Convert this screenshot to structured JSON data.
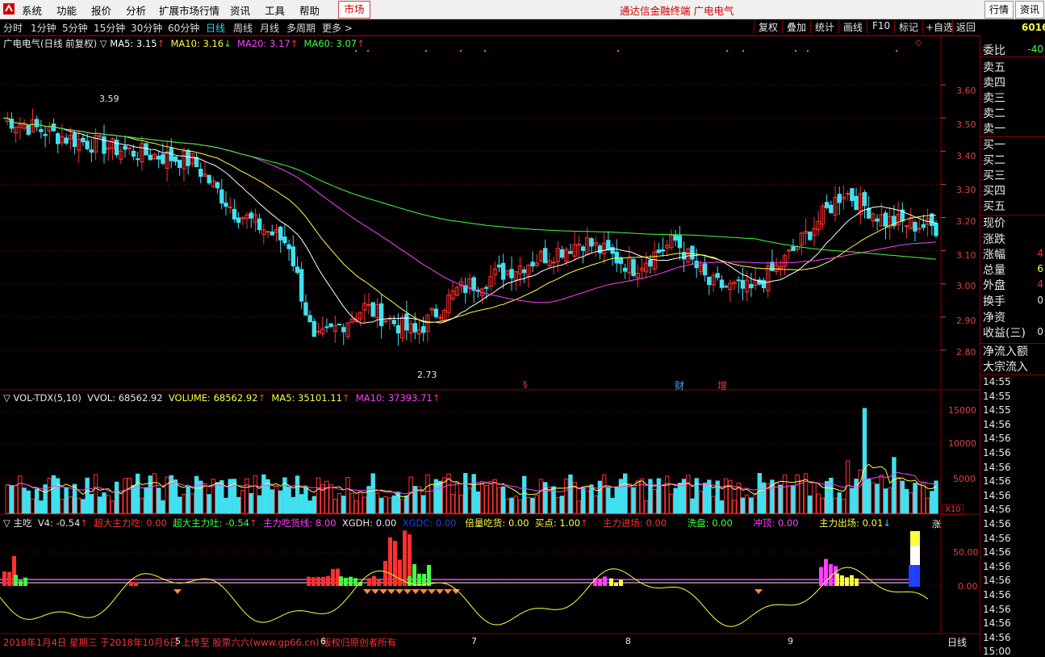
{
  "menu": {
    "items": [
      "系统",
      "功能",
      "报价",
      "分析",
      "扩展市场行情",
      "资讯",
      "工具",
      "帮助"
    ],
    "market_tab": "市场",
    "brand": "通达信金融终端  广电电气",
    "right_buttons": [
      "行情",
      "资讯"
    ]
  },
  "periods": [
    "分时",
    "1分钟",
    "5分钟",
    "15分钟",
    "30分钟",
    "60分钟",
    "日线",
    "周线",
    "月线",
    "多周期",
    "更多 >"
  ],
  "active_period": "日线",
  "tools": [
    "复权",
    "叠加",
    "统计",
    "画线",
    "F10",
    "标记",
    "+自选",
    "返回"
  ],
  "stock_code_partial": "6016",
  "main_chart": {
    "title": "广电电气(日线 前复权) ▽",
    "ma": [
      {
        "label": "MA5: 3.15",
        "arrow": "↑",
        "color": "#ffffff"
      },
      {
        "label": "MA10: 3.16",
        "arrow": "↓",
        "color": "#ffff40"
      },
      {
        "label": "MA20: 3.17",
        "arrow": "↑",
        "color": "#ff40ff"
      },
      {
        "label": "MA60: 3.07",
        "arrow": "↑",
        "color": "#40ff40"
      }
    ],
    "y_ticks": [
      "3.60",
      "3.50",
      "3.40",
      "3.30",
      "3.20",
      "3.10",
      "3.00",
      "2.90",
      "2.80"
    ],
    "ylim": [
      2.7,
      3.7
    ],
    "high_label": "3.59",
    "low_label": "2.73",
    "markers": [
      {
        "text": "§",
        "color": "#ff3030"
      },
      {
        "text": "财",
        "color": "#40a0ff"
      },
      {
        "text": "增",
        "color": "#ff3030"
      }
    ]
  },
  "volume_panel": {
    "name": "▽ VOL-TDX(5,10)",
    "vvol": "VVOL: 68562.92",
    "volume": "VOLUME: 68562.92",
    "ma5": "MA5: 35101.11",
    "ma10": "MA10: 37393.71",
    "y_ticks": [
      "15000",
      "10000",
      "5000"
    ],
    "scale": "X10"
  },
  "indicator_panel": {
    "name": "▽ 主吃",
    "fields": [
      {
        "label": "V4: -0.54",
        "arrow": "↑",
        "color": "#e8e8e8"
      },
      {
        "label": "超大主力吃: 0.00",
        "color": "#ff3030"
      },
      {
        "label": "超大主力吐: -0.54",
        "arrow": "↑",
        "color": "#40ff40"
      },
      {
        "label": "主力吃货线: 8.00",
        "color": "#ff40ff"
      },
      {
        "label": "XGDH: 0.00",
        "color": "#e8e8e8"
      },
      {
        "label": "XGDC: 0.00",
        "color": "#2040ff"
      },
      {
        "label": "倍量吃货: 0.00",
        "color": "#ffff40"
      },
      {
        "label": "买点: 1.00",
        "arrow": "↑",
        "color": "#ffff40"
      },
      {
        "label": "主力进场: 0.00",
        "color": "#ff3030"
      },
      {
        "label": "洗盘: 0.00",
        "color": "#40ff40"
      },
      {
        "label": "冲顶: 0.00",
        "color": "#ff40ff"
      },
      {
        "label": "主力出场: 0.01",
        "arrow": "↓",
        "color": "#ffff40"
      }
    ],
    "y_ticks": [
      "50.00",
      "0.00"
    ],
    "right_glyph": "涨"
  },
  "x_axis": {
    "labels": [
      "5",
      "6",
      "7",
      "8",
      "9"
    ],
    "footer_note": "2018年1月4日 星期三 于2018年10月6日 上传至 股票六六(www.gp66.cn) 版权归原创者所有",
    "period_label": "日线"
  },
  "right_panel": {
    "rows": [
      {
        "label": "委比",
        "value": "-40",
        "color": "#40ff40"
      },
      {
        "label": "卖五"
      },
      {
        "label": "卖四"
      },
      {
        "label": "卖三"
      },
      {
        "label": "卖二"
      },
      {
        "label": "卖一"
      },
      {
        "label": "买一"
      },
      {
        "label": "买二"
      },
      {
        "label": "买三"
      },
      {
        "label": "买四"
      },
      {
        "label": "买五"
      },
      {
        "label": "现价"
      },
      {
        "label": "涨跌"
      },
      {
        "label": "涨幅",
        "value": "4",
        "color": "#ff3030"
      },
      {
        "label": "总量",
        "value": "6",
        "color": "#ffff40"
      },
      {
        "label": "外盘",
        "value": "4",
        "color": "#ff3030"
      },
      {
        "label": "换手",
        "value": "0",
        "color": "#e8e8e8"
      },
      {
        "label": "净资"
      },
      {
        "label": "收益(三)",
        "value": "0",
        "color": "#e8e8e8"
      },
      {
        "label": "净流入额"
      },
      {
        "label": "大宗流入"
      }
    ],
    "times": [
      "14:55",
      "14:55",
      "14:55",
      "14:56",
      "14:56",
      "14:56",
      "14:56",
      "14:56",
      "14:56",
      "14:56",
      "14:56",
      "14:56",
      "14:56",
      "14:56",
      "14:56",
      "14:56",
      "14:56",
      "14:56",
      "14:56",
      "15:00"
    ]
  },
  "colors": {
    "up": "#ff3030",
    "down": "#40e0f0",
    "ma5": "#ffffff",
    "ma10": "#ffff40",
    "ma20": "#ff40ff",
    "ma60": "#40ff40",
    "grid": "#8a0000"
  }
}
